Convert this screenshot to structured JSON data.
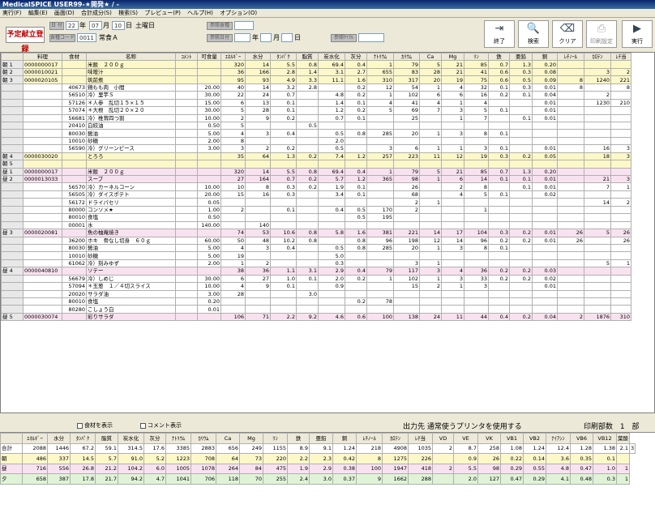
{
  "window": {
    "title": "MedicalSPICE  USER99-★開発★ / -"
  },
  "menu": [
    "実行(F)",
    "編集(E)",
    "画面(D)",
    "合計成分(S)",
    "検索(S)",
    "プレビュー(P)",
    "ヘルプ(H)",
    "オプション(O)"
  ],
  "header": {
    "page_title": "予定献立登録",
    "date_label": "日 付",
    "year": "22",
    "year_unit": "年",
    "month": "07",
    "month_unit": "月",
    "day": "10",
    "day_unit": "日",
    "weekday": "土曜日",
    "meal_type_btn": "食種コード",
    "meal_type_code": "0011",
    "meal_type_name": "常食Ａ",
    "ref_meal_btn": "参照食種",
    "ref_date_btn": "参照日付",
    "ref_year_unit": "年",
    "ref_month_unit": "月",
    "ref_day_unit": "日",
    "ref_cycle_btn": "参照ｻｲｸﾙ"
  },
  "toolbar": [
    {
      "label": "終了",
      "icon": "exit-icon"
    },
    {
      "label": "検索",
      "icon": "search-icon"
    },
    {
      "label": "クリア",
      "icon": "clear-icon"
    },
    {
      "label": "印刷設定",
      "icon": "print-settings-icon"
    },
    {
      "label": "実行",
      "icon": "run-icon"
    }
  ],
  "grid": {
    "columns": [
      "",
      "料理",
      "食材",
      "名称",
      "ｺﾒﾝﾄ",
      "可食量",
      "ｴﾈﾙｷﾞｰ",
      "水分",
      "ﾀﾝﾊﾟｸ",
      "脂質",
      "炭水化",
      "灰分",
      "ﾅﾄﾘｳﾑ",
      "ｶﾘｳﾑ",
      "Ca",
      "Mg",
      "ﾘﾝ",
      "鉄",
      "亜鉛",
      "銅",
      "ﾚﾁﾉｰﾙ",
      "ｶﾛﾃﾝ",
      "ﾚﾁ当"
    ],
    "rows": [
      {
        "style": "hy",
        "c": [
          "朝 1",
          "0000000017",
          "",
          "米飯　２００ｇ",
          "",
          "",
          "320",
          "14",
          "5.5",
          "0.8",
          "69.4",
          "0.4",
          "1",
          "79",
          "5",
          "21",
          "85",
          "0.7",
          "1.3",
          "0.20",
          "",
          "",
          ""
        ]
      },
      {
        "style": "hy",
        "c": [
          "朝 2",
          "0000010021",
          "",
          "味噌汁",
          "",
          "",
          "36",
          "166",
          "2.8",
          "1.4",
          "3.1",
          "2.7",
          "655",
          "83",
          "28",
          "21",
          "41",
          "0.6",
          "0.3",
          "0.08",
          "",
          "3",
          "2"
        ]
      },
      {
        "style": "hy",
        "c": [
          "朝 3",
          "0000020105",
          "",
          "筑前煮",
          "",
          "",
          "95",
          "93",
          "4.9",
          "3.3",
          "11.1",
          "1.6",
          "310",
          "317",
          "20",
          "19",
          "75",
          "0.6",
          "0.5",
          "0.09",
          "8",
          "1240",
          "221"
        ]
      },
      {
        "style": "",
        "c": [
          "",
          "",
          "40673",
          "鶏もも肉　小間",
          "",
          "20.00",
          "40",
          "14",
          "3.2",
          "2.8",
          "",
          "0.2",
          "12",
          "54",
          "1",
          "4",
          "32",
          "0.1",
          "0.3",
          "0.01",
          "8",
          "",
          "8"
        ]
      },
      {
        "style": "",
        "c": [
          "",
          "",
          "56510",
          "冷）里芋Ｓ",
          "",
          "30.00",
          "22",
          "24",
          "0.7",
          "",
          "4.8",
          "0.2",
          "1",
          "102",
          "6",
          "6",
          "16",
          "0.2",
          "0.1",
          "0.04",
          "",
          "2",
          ""
        ]
      },
      {
        "style": "",
        "c": [
          "",
          "",
          "57126",
          "＊人参　乱切１５×１５",
          "",
          "15.00",
          "6",
          "13",
          "0.1",
          "",
          "1.4",
          "0.1",
          "4",
          "41",
          "4",
          "1",
          "4",
          "",
          "",
          "0.01",
          "",
          "1230",
          "210"
        ]
      },
      {
        "style": "",
        "c": [
          "",
          "",
          "57074",
          "＊大根　乱切２０×２０",
          "",
          "30.00",
          "5",
          "28",
          "0.1",
          "",
          "1.2",
          "0.2",
          "5",
          "69",
          "7",
          "3",
          "5",
          "0.1",
          "",
          "0.01",
          "",
          "",
          ""
        ]
      },
      {
        "style": "",
        "c": [
          "",
          "",
          "56681",
          "冷）椎茸四つ割",
          "",
          "10.00",
          "2",
          "9",
          "0.2",
          "",
          "0.7",
          "0.1",
          "",
          "25",
          "",
          "1",
          "7",
          "",
          "0.1",
          "0.01",
          "",
          "",
          ""
        ]
      },
      {
        "style": "",
        "c": [
          "",
          "",
          "20410",
          "白絞油",
          "",
          "0.50",
          "5",
          "",
          "",
          "0.5",
          "",
          "",
          "",
          "",
          "",
          "",
          "",
          "",
          "",
          "",
          "",
          "",
          ""
        ]
      },
      {
        "style": "",
        "c": [
          "",
          "",
          "80030",
          "醤油",
          "",
          "5.00",
          "4",
          "3",
          "0.4",
          "",
          "0.5",
          "0.8",
          "285",
          "20",
          "1",
          "3",
          "8",
          "0.1",
          "",
          "",
          "",
          "",
          ""
        ]
      },
      {
        "style": "",
        "c": [
          "",
          "",
          "10010",
          "砂糖",
          "",
          "2.00",
          "8",
          "",
          "",
          "",
          "2.0",
          "",
          "",
          "",
          "",
          "",
          "",
          "",
          "",
          "",
          "",
          "",
          ""
        ]
      },
      {
        "style": "",
        "c": [
          "",
          "",
          "56590",
          "冷）グリーンピース",
          "",
          "3.00",
          "3",
          "2",
          "0.2",
          "",
          "0.5",
          "",
          "3",
          "6",
          "1",
          "1",
          "3",
          "0.1",
          "",
          "0.01",
          "",
          "16",
          "3"
        ]
      },
      {
        "style": "hy",
        "c": [
          "朝 4",
          "0000030020",
          "",
          "とろろ",
          "",
          "",
          "35",
          "64",
          "1.3",
          "0.2",
          "7.4",
          "1.2",
          "257",
          "223",
          "11",
          "12",
          "19",
          "0.3",
          "0.2",
          "0.05",
          "",
          "18",
          "3"
        ]
      },
      {
        "style": "hy",
        "c": [
          "朝 5",
          "",
          "",
          "",
          "",
          "",
          "",
          "",
          "",
          "",
          "",
          "",
          "",
          "",
          "",
          "",
          "",
          "",
          "",
          "",
          "",
          "",
          ""
        ]
      },
      {
        "style": "hp",
        "c": [
          "昼 1",
          "0000000017",
          "",
          "米飯　２００ｇ",
          "",
          "",
          "320",
          "14",
          "5.5",
          "0.8",
          "69.4",
          "0.4",
          "1",
          "79",
          "5",
          "21",
          "85",
          "0.7",
          "1.3",
          "0.20",
          "",
          "",
          ""
        ]
      },
      {
        "style": "hp",
        "c": [
          "昼 2",
          "0000013033",
          "",
          "スープ",
          "",
          "",
          "27",
          "164",
          "0.7",
          "0.2",
          "5.7",
          "1.2",
          "365",
          "98",
          "1",
          "6",
          "14",
          "0.1",
          "0.1",
          "0.01",
          "",
          "21",
          "3"
        ]
      },
      {
        "style": "",
        "c": [
          "",
          "",
          "56570",
          "冷）カーネルコーン",
          "",
          "10.00",
          "10",
          "8",
          "0.3",
          "0.2",
          "1.9",
          "0.1",
          "",
          "26",
          "",
          "2",
          "8",
          "",
          "0.1",
          "0.01",
          "",
          "7",
          "1"
        ]
      },
      {
        "style": "",
        "c": [
          "",
          "",
          "56505",
          "冷）ダイスポテト",
          "",
          "20.00",
          "15",
          "16",
          "0.3",
          "",
          "3.4",
          "0.1",
          "",
          "68",
          "",
          "4",
          "5",
          "0.1",
          "",
          "0.02",
          "",
          "",
          ""
        ]
      },
      {
        "style": "",
        "c": [
          "",
          "",
          "56172",
          "ドライパセリ",
          "",
          "0.05",
          "",
          "",
          "",
          "",
          "",
          "",
          "",
          "2",
          "1",
          "",
          "",
          "",
          "",
          "",
          "",
          "14",
          "2"
        ]
      },
      {
        "style": "",
        "c": [
          "",
          "",
          "80000",
          "コンソメ★",
          "",
          "1.00",
          "2",
          "",
          "0.1",
          "",
          "0.4",
          "0.5",
          "170",
          "2",
          "",
          "",
          "1",
          "",
          "",
          "",
          "",
          "",
          ""
        ]
      },
      {
        "style": "",
        "c": [
          "",
          "",
          "80010",
          "食塩",
          "",
          "0.50",
          "",
          "",
          "",
          "",
          "",
          "0.5",
          "195",
          "",
          "",
          "",
          "",
          "",
          "",
          "",
          "",
          "",
          ""
        ]
      },
      {
        "style": "",
        "c": [
          "",
          "",
          "00001",
          "水",
          "",
          "140.00",
          "",
          "140",
          "",
          "",
          "",
          "",
          "",
          "",
          "",
          "",
          "",
          "",
          "",
          "",
          "",
          "",
          ""
        ]
      },
      {
        "style": "hp",
        "c": [
          "昼 3",
          "0000020081",
          "",
          "魚の柚庵焼き",
          "",
          "",
          "74",
          "53",
          "10.6",
          "0.8",
          "5.8",
          "1.6",
          "381",
          "221",
          "14",
          "17",
          "104",
          "0.3",
          "0.2",
          "0.01",
          "26",
          "5",
          "26"
        ]
      },
      {
        "style": "",
        "c": [
          "",
          "",
          "36200",
          "ホキ　骨なし切身　６０ｇ",
          "",
          "60.00",
          "50",
          "48",
          "10.2",
          "0.8",
          "",
          "0.8",
          "96",
          "198",
          "12",
          "14",
          "96",
          "0.2",
          "0.2",
          "0.01",
          "26",
          "",
          "26"
        ]
      },
      {
        "style": "",
        "c": [
          "",
          "",
          "80030",
          "醤油",
          "",
          "5.00",
          "4",
          "3",
          "0.4",
          "",
          "0.5",
          "0.8",
          "285",
          "20",
          "1",
          "3",
          "8",
          "0.1",
          "",
          "",
          "",
          "",
          ""
        ]
      },
      {
        "style": "",
        "c": [
          "",
          "",
          "10010",
          "砂糖",
          "",
          "5.00",
          "19",
          "",
          "",
          "",
          "5.0",
          "",
          "",
          "",
          "",
          "",
          "",
          "",
          "",
          "",
          "",
          "",
          ""
        ]
      },
      {
        "style": "",
        "c": [
          "",
          "",
          "61062",
          "冷）刻みゆず",
          "",
          "2.00",
          "1",
          "2",
          "",
          "",
          "0.3",
          "",
          "",
          "3",
          "1",
          "",
          "",
          "",
          "",
          "",
          "",
          "5",
          "1"
        ]
      },
      {
        "style": "hp",
        "c": [
          "昼 4",
          "0000040810",
          "",
          "ソテー",
          "",
          "",
          "38",
          "36",
          "1.1",
          "3.1",
          "2.9",
          "0.4",
          "79",
          "117",
          "3",
          "4",
          "36",
          "0.2",
          "0.2",
          "0.03",
          "",
          "",
          ""
        ]
      },
      {
        "style": "",
        "c": [
          "",
          "",
          "56679",
          "冷）しめじ",
          "",
          "30.00",
          "6",
          "27",
          "1.0",
          "0.1",
          "2.0",
          "0.2",
          "1",
          "102",
          "1",
          "3",
          "33",
          "0.2",
          "0.2",
          "0.02",
          "",
          "",
          ""
        ]
      },
      {
        "style": "",
        "c": [
          "",
          "",
          "57094",
          "＊玉葱　１／４切スライス",
          "",
          "10.00",
          "4",
          "9",
          "0.1",
          "",
          "0.9",
          "",
          "",
          "15",
          "2",
          "1",
          "3",
          "",
          "",
          "0.01",
          "",
          "",
          ""
        ]
      },
      {
        "style": "",
        "c": [
          "",
          "",
          "20020",
          "サラダ油",
          "",
          "3.00",
          "28",
          "",
          "",
          "3.0",
          "",
          "",
          "",
          "",
          "",
          "",
          "",
          "",
          "",
          "",
          "",
          "",
          ""
        ]
      },
      {
        "style": "",
        "c": [
          "",
          "",
          "80010",
          "食塩",
          "",
          "0.20",
          "",
          "",
          "",
          "",
          "",
          "0.2",
          "78",
          "",
          "",
          "",
          "",
          "",
          "",
          "",
          "",
          "",
          ""
        ]
      },
      {
        "style": "",
        "c": [
          "",
          "",
          "80280",
          "こしょう白",
          "",
          "0.01",
          "",
          "",
          "",
          "",
          "",
          "",
          "",
          "",
          "",
          "",
          "",
          "",
          "",
          "",
          "",
          "",
          ""
        ]
      },
      {
        "style": "hp",
        "c": [
          "昼 5",
          "0000030074",
          "",
          "彩りサラダ",
          "",
          "",
          "106",
          "71",
          "2.2",
          "9.2",
          "4.6",
          "0.6",
          "100",
          "138",
          "24",
          "11",
          "44",
          "0.4",
          "0.2",
          "0.04",
          "2",
          "1876",
          "310"
        ]
      }
    ]
  },
  "options": {
    "show_ingredients": "食材を表示",
    "show_comments": "コメント表示",
    "output_label": "出力先",
    "output_value": "通常使うプリンタを使用する",
    "copies_label": "印刷部数",
    "copies_value": "1",
    "copies_unit": "部"
  },
  "summary": {
    "columns": [
      "",
      "ｴﾈﾙｷﾞｰ",
      "水分",
      "ﾀﾝﾊﾟｸ",
      "脂質",
      "炭水化",
      "灰分",
      "ﾅﾄﾘｳﾑ",
      "ｶﾘｳﾑ",
      "Ca",
      "Mg",
      "ﾘﾝ",
      "鉄",
      "亜鉛",
      "銅",
      "ﾚﾁﾉｰﾙ",
      "ｶﾛﾃﾝ",
      "ﾚﾁ当",
      "VD",
      "VE",
      "VK",
      "VB1",
      "VB2",
      "ﾅｲｱｼﾝ",
      "VB6",
      "VB12",
      "葉酸"
    ],
    "rows": [
      {
        "style": "",
        "c": [
          "合計",
          "2088",
          "1446",
          "67.2",
          "59.1",
          "314.5",
          "17.6",
          "3385",
          "2883",
          "656",
          "249",
          "1155",
          "8.9",
          "9.1",
          "1.24",
          "218",
          "4908",
          "1035",
          "2",
          "8.7",
          "258",
          "1.08",
          "1.24",
          "12.4",
          "1.28",
          "1.38",
          "2.1",
          "3"
        ]
      },
      {
        "style": "sy",
        "c": [
          "朝",
          "486",
          "337",
          "14.5",
          "5.7",
          "91.0",
          "5.2",
          "1223",
          "708",
          "64",
          "73",
          "220",
          "2.2",
          "2.3",
          "0.42",
          "8",
          "1275",
          "226",
          "",
          "0.9",
          "26",
          "0.22",
          "0.14",
          "3.6",
          "0.35",
          "0.1",
          ""
        ]
      },
      {
        "style": "sp",
        "c": [
          "昼",
          "716",
          "556",
          "26.8",
          "21.2",
          "104.2",
          "6.0",
          "1005",
          "1078",
          "264",
          "84",
          "475",
          "1.9",
          "2.9",
          "0.38",
          "100",
          "1947",
          "418",
          "2",
          "5.5",
          "98",
          "0.29",
          "0.55",
          "4.8",
          "0.47",
          "1.0",
          "1"
        ]
      },
      {
        "style": "sg",
        "c": [
          "夕",
          "658",
          "387",
          "17.8",
          "21.7",
          "94.2",
          "4.7",
          "1041",
          "706",
          "118",
          "70",
          "255",
          "2.4",
          "3.0",
          "0.37",
          "9",
          "1662",
          "288",
          "",
          "2.0",
          "127",
          "0.47",
          "0.29",
          "4.1",
          "0.48",
          "0.3",
          "1"
        ]
      }
    ]
  }
}
